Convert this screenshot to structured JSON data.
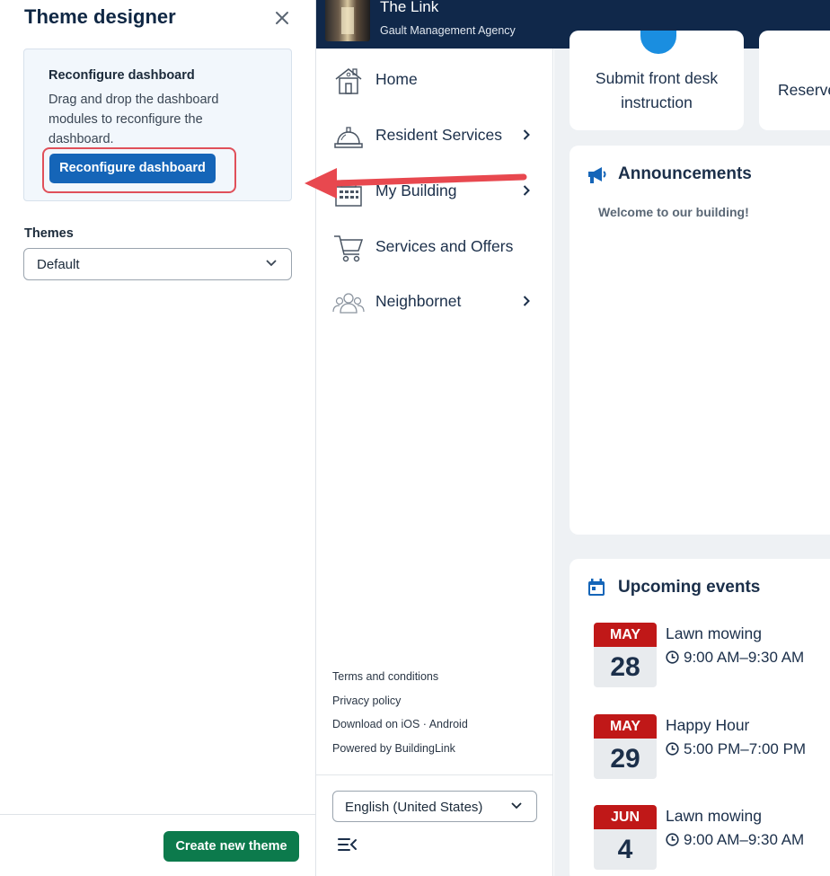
{
  "designer": {
    "title": "Theme designer",
    "reconfigure": {
      "heading": "Reconfigure dashboard",
      "description": "Drag and drop the dashboard modules to reconfigure the dashboard.",
      "button_label": "Reconfigure dashboard"
    },
    "themes": {
      "label": "Themes",
      "selected": "Default"
    },
    "create_button_label": "Create new theme"
  },
  "header": {
    "building_name": "The Link",
    "agency": "Gault Management Agency"
  },
  "nav": {
    "items": [
      {
        "label": "Home",
        "icon": "house-icon"
      },
      {
        "label": "Resident Services",
        "icon": "service-bell-icon"
      },
      {
        "label": "My Building",
        "icon": "building-icon"
      },
      {
        "label": "Services and Offers",
        "icon": "shopping-cart-icon"
      },
      {
        "label": "Neighbornet",
        "icon": "people-icon"
      }
    ],
    "links": [
      "Terms and conditions",
      "Privacy policy",
      "Download on iOS · Android",
      "Powered by BuildingLink"
    ],
    "language": "English (United States)"
  },
  "main": {
    "tiles": [
      {
        "label": "Submit front desk instruction"
      },
      {
        "label": "Reserve"
      }
    ],
    "announcements": {
      "title": "Announcements",
      "text": "Welcome to our building!"
    },
    "events": {
      "title": "Upcoming events",
      "items": [
        {
          "month": "MAY",
          "day": "28",
          "name": "Lawn mowing",
          "time": "9:00 AM–9:30 AM"
        },
        {
          "month": "MAY",
          "day": "29",
          "name": "Happy Hour",
          "time": "5:00 PM–7:00 PM"
        },
        {
          "month": "JUN",
          "day": "4",
          "name": "Lawn mowing",
          "time": "9:00 AM–9:30 AM"
        }
      ]
    }
  },
  "colors": {
    "header_bg": "#10284a",
    "primary_button": "#1565b8",
    "create_button": "#0c7a4c",
    "calendar_red": "#c01818",
    "highlight_red": "#e0505a"
  }
}
